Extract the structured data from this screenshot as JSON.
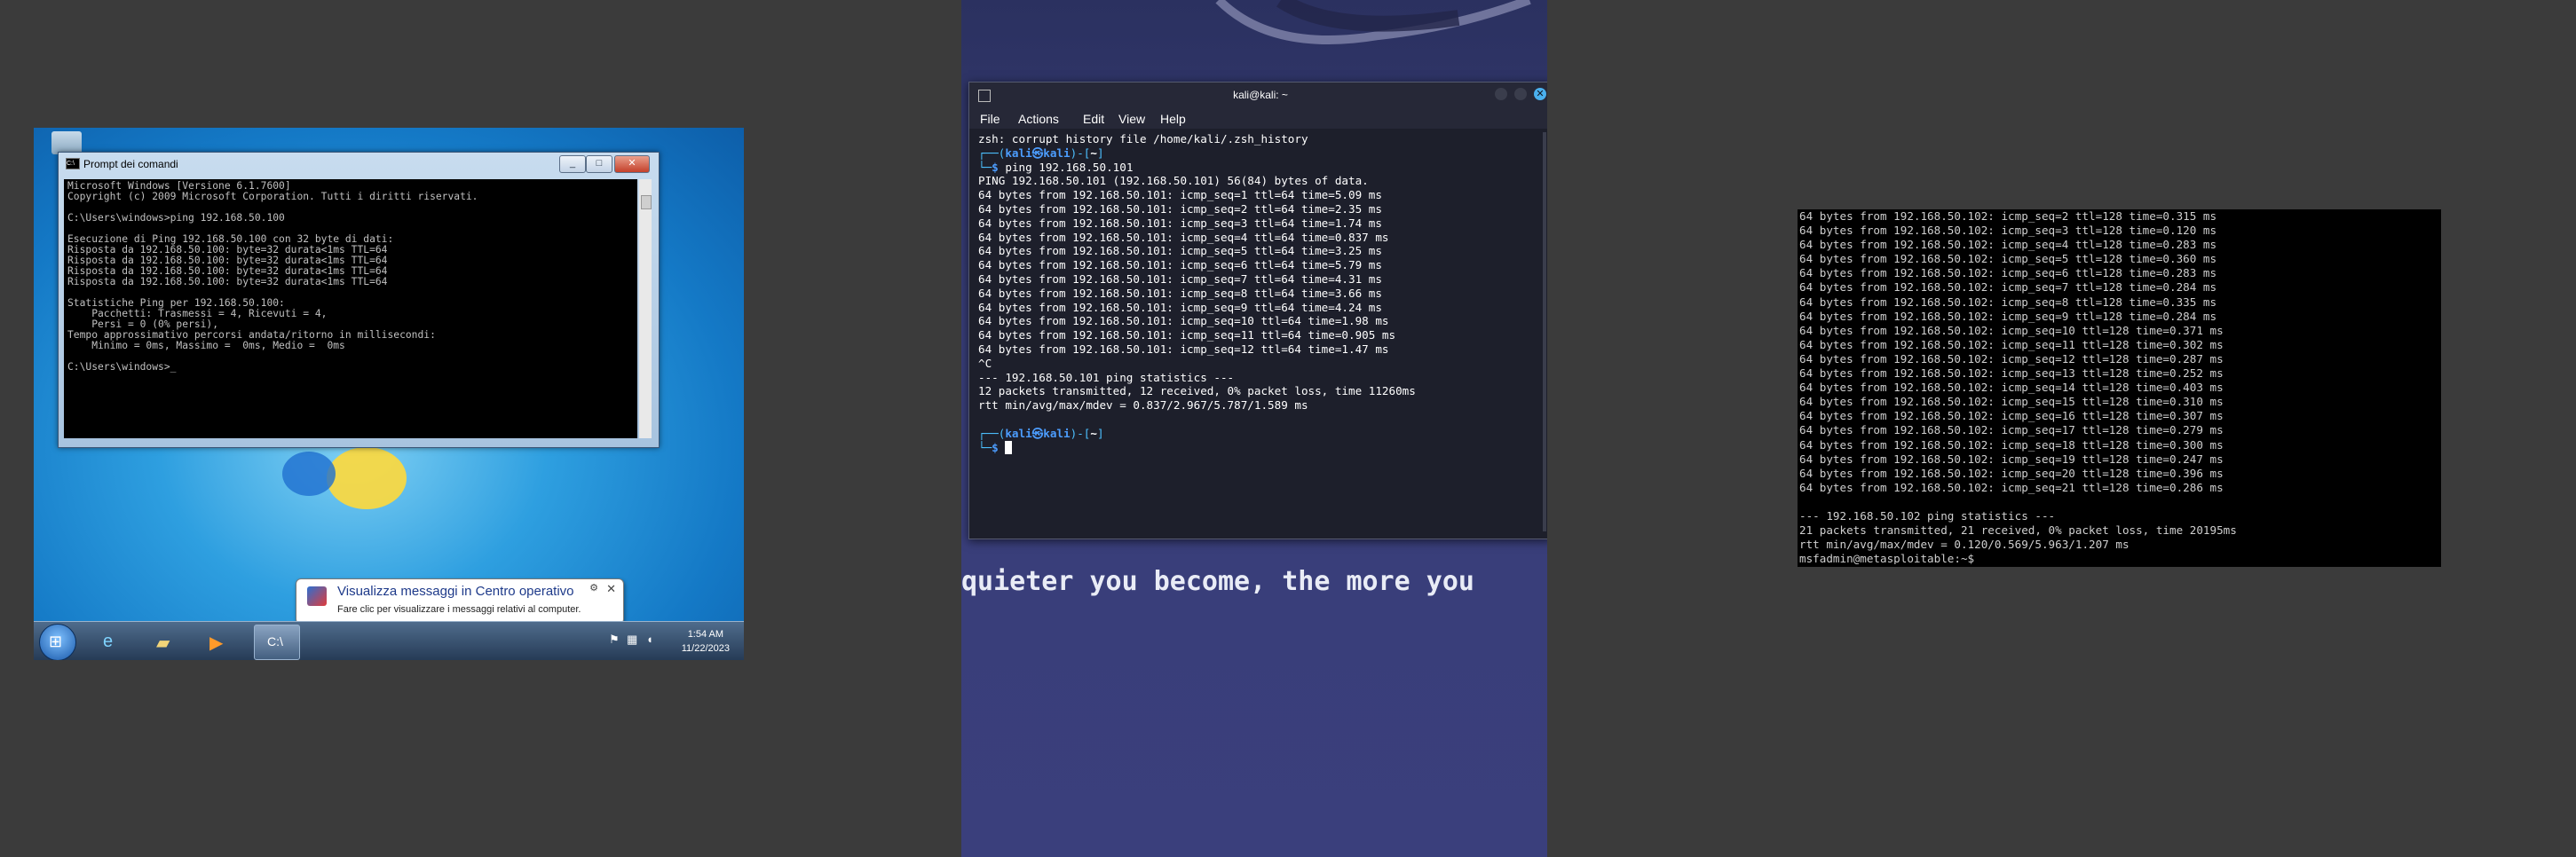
{
  "win7": {
    "cmd_title": "Prompt dei comandi",
    "cmd_lines": [
      "Microsoft Windows [Versione 6.1.7600]",
      "Copyright (c) 2009 Microsoft Corporation. Tutti i diritti riservati.",
      "",
      "C:\\Users\\windows>ping 192.168.50.100",
      "",
      "Esecuzione di Ping 192.168.50.100 con 32 byte di dati:",
      "Risposta da 192.168.50.100: byte=32 durata<1ms TTL=64",
      "Risposta da 192.168.50.100: byte=32 durata<1ms TTL=64",
      "Risposta da 192.168.50.100: byte=32 durata<1ms TTL=64",
      "Risposta da 192.168.50.100: byte=32 durata<1ms TTL=64",
      "",
      "Statistiche Ping per 192.168.50.100:",
      "    Pacchetti: Trasmessi = 4, Ricevuti = 4,",
      "    Persi = 0 (0% persi),",
      "Tempo approssimativo percorsi andata/ritorno in millisecondi:",
      "    Minimo = 0ms, Massimo =  0ms, Medio =  0ms",
      "",
      "C:\\Users\\windows>_"
    ],
    "balloon": {
      "title": "Visualizza messaggi in Centro operativo",
      "text": "Fare clic per visualizzare i messaggi relativi al computer."
    },
    "clock_time": "1:54 AM",
    "clock_date": "11/22/2023"
  },
  "kali": {
    "window_title": "kali@kali: ~",
    "menu": [
      "File",
      "Actions",
      "Edit",
      "View",
      "Help"
    ],
    "lines": [
      "zsh: corrupt history file /home/kali/.zsh_history",
      "PING 192.168.50.101 (192.168.50.101) 56(84) bytes of data.",
      "64 bytes from 192.168.50.101: icmp_seq=1 ttl=64 time=5.09 ms",
      "64 bytes from 192.168.50.101: icmp_seq=2 ttl=64 time=2.35 ms",
      "64 bytes from 192.168.50.101: icmp_seq=3 ttl=64 time=1.74 ms",
      "64 bytes from 192.168.50.101: icmp_seq=4 ttl=64 time=0.837 ms",
      "64 bytes from 192.168.50.101: icmp_seq=5 ttl=64 time=3.25 ms",
      "64 bytes from 192.168.50.101: icmp_seq=6 ttl=64 time=5.79 ms",
      "64 bytes from 192.168.50.101: icmp_seq=7 ttl=64 time=4.31 ms",
      "64 bytes from 192.168.50.101: icmp_seq=8 ttl=64 time=3.66 ms",
      "64 bytes from 192.168.50.101: icmp_seq=9 ttl=64 time=4.24 ms",
      "64 bytes from 192.168.50.101: icmp_seq=10 ttl=64 time=1.98 ms",
      "64 bytes from 192.168.50.101: icmp_seq=11 ttl=64 time=0.905 ms",
      "64 bytes from 192.168.50.101: icmp_seq=12 ttl=64 time=1.47 ms",
      "^C",
      "--- 192.168.50.101 ping statistics ---",
      "12 packets transmitted, 12 received, 0% packet loss, time 11260ms",
      "rtt min/avg/max/mdev = 0.837/2.967/5.787/1.589 ms"
    ],
    "prompt_user": "kali",
    "prompt_host": "kali",
    "prompt_dir": "~",
    "command": "ping 192.168.50.101",
    "quote": "quieter you become, the more you"
  },
  "meta": {
    "lines": [
      "64 bytes from 192.168.50.102: icmp_seq=2 ttl=128 time=0.315 ms",
      "64 bytes from 192.168.50.102: icmp_seq=3 ttl=128 time=0.120 ms",
      "64 bytes from 192.168.50.102: icmp_seq=4 ttl=128 time=0.283 ms",
      "64 bytes from 192.168.50.102: icmp_seq=5 ttl=128 time=0.360 ms",
      "64 bytes from 192.168.50.102: icmp_seq=6 ttl=128 time=0.283 ms",
      "64 bytes from 192.168.50.102: icmp_seq=7 ttl=128 time=0.284 ms",
      "64 bytes from 192.168.50.102: icmp_seq=8 ttl=128 time=0.335 ms",
      "64 bytes from 192.168.50.102: icmp_seq=9 ttl=128 time=0.284 ms",
      "64 bytes from 192.168.50.102: icmp_seq=10 ttl=128 time=0.371 ms",
      "64 bytes from 192.168.50.102: icmp_seq=11 ttl=128 time=0.302 ms",
      "64 bytes from 192.168.50.102: icmp_seq=12 ttl=128 time=0.287 ms",
      "64 bytes from 192.168.50.102: icmp_seq=13 ttl=128 time=0.252 ms",
      "64 bytes from 192.168.50.102: icmp_seq=14 ttl=128 time=0.403 ms",
      "64 bytes from 192.168.50.102: icmp_seq=15 ttl=128 time=0.310 ms",
      "64 bytes from 192.168.50.102: icmp_seq=16 ttl=128 time=0.307 ms",
      "64 bytes from 192.168.50.102: icmp_seq=17 ttl=128 time=0.279 ms",
      "64 bytes from 192.168.50.102: icmp_seq=18 ttl=128 time=0.300 ms",
      "64 bytes from 192.168.50.102: icmp_seq=19 ttl=128 time=0.247 ms",
      "64 bytes from 192.168.50.102: icmp_seq=20 ttl=128 time=0.396 ms",
      "64 bytes from 192.168.50.102: icmp_seq=21 ttl=128 time=0.286 ms",
      "",
      "--- 192.168.50.102 ping statistics ---",
      "21 packets transmitted, 21 received, 0% packet loss, time 20195ms",
      "rtt min/avg/max/mdev = 0.120/0.569/5.963/1.207 ms",
      "msfadmin@metasploitable:~$"
    ]
  },
  "colors": {
    "desktop_bg": "#3b3b3b",
    "kali_prompt": "#4cc0ff",
    "win7_sky": "#2e9fe0"
  }
}
